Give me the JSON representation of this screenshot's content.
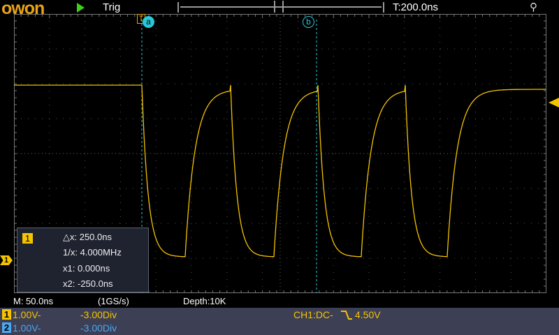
{
  "header": {
    "logo": "owon",
    "run_state": "Trig",
    "timebase_pos": "T:200.0ns",
    "run_icon": "play-icon",
    "usb_icon": "usb-icon"
  },
  "cursors": {
    "trigger_marker": "T",
    "cursor_a": "a",
    "cursor_b": "b"
  },
  "measure": {
    "channel": "1",
    "dx": "△x: 250.0ns",
    "inv_dx": "1/x: 4.000MHz",
    "x1": "x1: 0.000ns",
    "x2": "x2: -250.0ns"
  },
  "status": {
    "timebase": "M: 50.0ns",
    "sample_rate": "(1GS/s)",
    "depth": "Depth:10K"
  },
  "channels": [
    {
      "num": "1",
      "scale": "1.00V-",
      "offset": "-3.00Div",
      "color": "#f5c400"
    },
    {
      "num": "2",
      "scale": "1.00V-",
      "offset": "-3.00Div",
      "color": "#4aa8f0"
    }
  ],
  "trigger": {
    "label": "CH1:DC-",
    "slope_icon": "falling-edge-icon",
    "level": "4.50V"
  },
  "colors": {
    "ch1": "#f5c400",
    "ch2": "#4aa8f0",
    "cursor": "#28c8d8",
    "orange": "#e8a317"
  }
}
